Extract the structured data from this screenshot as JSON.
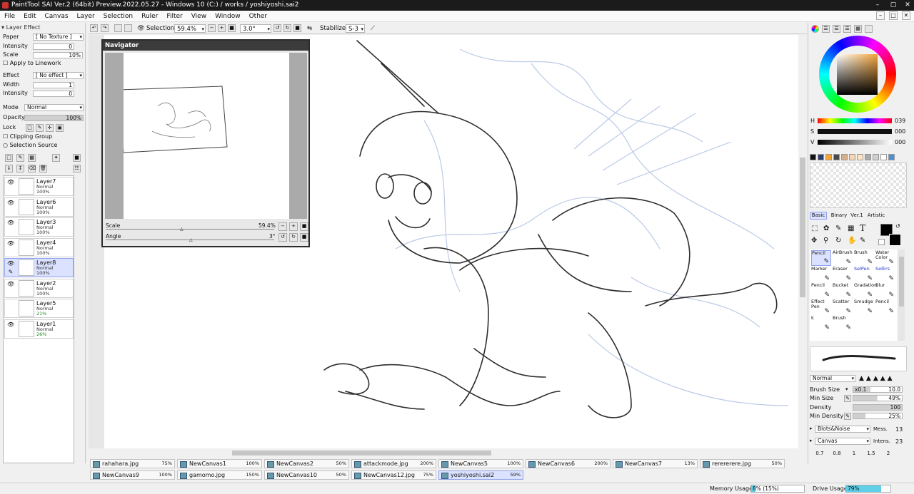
{
  "window": {
    "title": "PaintTool SAI Ver.2 (64bit) Preview.2022.05.27 - Windows 10 (C:) / works / yoshiyoshi.sai2"
  },
  "menu": [
    "File",
    "Edit",
    "Canvas",
    "Layer",
    "Selection",
    "Ruler",
    "Filter",
    "View",
    "Window",
    "Other"
  ],
  "layer_effect": {
    "header": "Layer Effect",
    "paper_label": "Paper",
    "paper_value": "[ No Texture ]",
    "intensity_label": "Intensity",
    "intensity_value": "0",
    "scale_label": "Scale",
    "scale_value": "10%",
    "apply_linework": "Apply to Linework",
    "effect_label": "Effect",
    "effect_value": "[ No effect ]",
    "width_label": "Width",
    "width_value": "1",
    "intensity2_label": "Intensity",
    "intensity2_value": "0"
  },
  "layer_props": {
    "mode_label": "Mode",
    "mode_value": "Normal",
    "opacity_label": "Opacity",
    "opacity_value": "100%",
    "lock_label": "Lock",
    "clipping_group": "Clipping Group",
    "selection_source": "Selection Source"
  },
  "layers": [
    {
      "name": "Layer7",
      "mode": "Normal",
      "opacity": "100%"
    },
    {
      "name": "Layer6",
      "mode": "Normal",
      "opacity": "100%"
    },
    {
      "name": "Layer3",
      "mode": "Normal",
      "opacity": "100%"
    },
    {
      "name": "Layer4",
      "mode": "Normal",
      "opacity": "100%"
    },
    {
      "name": "Layer8",
      "mode": "Normal",
      "opacity": "100%"
    },
    {
      "name": "Layer2",
      "mode": "Normal",
      "opacity": "100%"
    },
    {
      "name": "Layer5",
      "mode": "Normal",
      "opacity": "21%"
    },
    {
      "name": "Layer1",
      "mode": "Normal",
      "opacity": "26%"
    }
  ],
  "toolbar": {
    "selection_label": "Selection",
    "zoom": "59.4%",
    "angle": "3.0°",
    "stabilizer_label": "Stabilizer",
    "stabilizer_value": "S-3"
  },
  "navigator": {
    "title": "Navigator",
    "scale_label": "Scale",
    "scale_value": "59.4%",
    "angle_label": "Angle",
    "angle_value": "3°"
  },
  "color": {
    "h_label": "H",
    "h_value": "039",
    "s_label": "S",
    "s_value": "000",
    "v_label": "V",
    "v_value": "000",
    "swatches": [
      "#111111",
      "#2c3e6e",
      "#f3a531",
      "#4a4a4a",
      "#d6b08a",
      "#f6d6b0",
      "#ffe3c2",
      "#a9a9a9",
      "#cfcfcf",
      "#ffffff",
      "#4f8fd8"
    ]
  },
  "tool_tabs": [
    "Basic",
    "Binary",
    "Ver.1",
    "Artistic"
  ],
  "tools": [
    {
      "label": "Pencil",
      "sel": true
    },
    {
      "label": "AirBrush"
    },
    {
      "label": "Brush"
    },
    {
      "label": "Water Color"
    },
    {
      "label": "Marker"
    },
    {
      "label": "Eraser"
    },
    {
      "label": "SelPen",
      "blue": true
    },
    {
      "label": "SelErs",
      "blue": true
    },
    {
      "label": "Pencil"
    },
    {
      "label": "Bucket"
    },
    {
      "label": "Gradation"
    },
    {
      "label": "Blur"
    },
    {
      "label": "Effect Pen"
    },
    {
      "label": "Scatter"
    },
    {
      "label": "Smudge"
    },
    {
      "label": "Pencil"
    },
    {
      "label": "k"
    },
    {
      "label": "Brush"
    }
  ],
  "brush": {
    "blend_mode": "Normal",
    "size_label": "Brush Size",
    "size_mult": "x0.1",
    "size_value": "10.0",
    "min_size_label": "Min Size",
    "min_size_value": "49%",
    "density_label": "Density",
    "density_value": "100",
    "min_density_label": "Min Density",
    "min_density_value": "25%",
    "texture1": "Blots&Noise",
    "texture1_param": "Mess.",
    "texture1_value": "13",
    "texture2": "Canvas",
    "texture2_param": "Intens.",
    "texture2_value": "23",
    "size_presets": [
      "0.7",
      "0.8",
      "1",
      "1.5",
      "2"
    ]
  },
  "canvas_tabs": [
    {
      "name": "rahahara.jpg",
      "pct": "75%"
    },
    {
      "name": "NewCanvas1",
      "pct": "100%"
    },
    {
      "name": "NewCanvas2",
      "pct": "50%"
    },
    {
      "name": "attackmode.jpg",
      "pct": "200%"
    },
    {
      "name": "NewCanvas5",
      "pct": "100%"
    },
    {
      "name": "NewCanvas6",
      "pct": "200%"
    },
    {
      "name": "NewCanvas7",
      "pct": "13%"
    },
    {
      "name": "rerererere.jpg",
      "pct": "50%"
    },
    {
      "name": "NewCanvas9",
      "pct": "100%"
    },
    {
      "name": "gamomo.jpg",
      "pct": "150%"
    },
    {
      "name": "NewCanvas10",
      "pct": "50%"
    },
    {
      "name": "NewCanvas12.jpg",
      "pct": "75%"
    },
    {
      "name": "yoshiyoshi.sai2",
      "pct": "59%",
      "sel": true
    }
  ],
  "status": {
    "memory_label": "Memory Usage",
    "memory_value": "8% (15%)",
    "memory_fraction": 0.08,
    "drive_label": "Drive Usage",
    "drive_value": "79%",
    "drive_fraction": 0.79
  }
}
